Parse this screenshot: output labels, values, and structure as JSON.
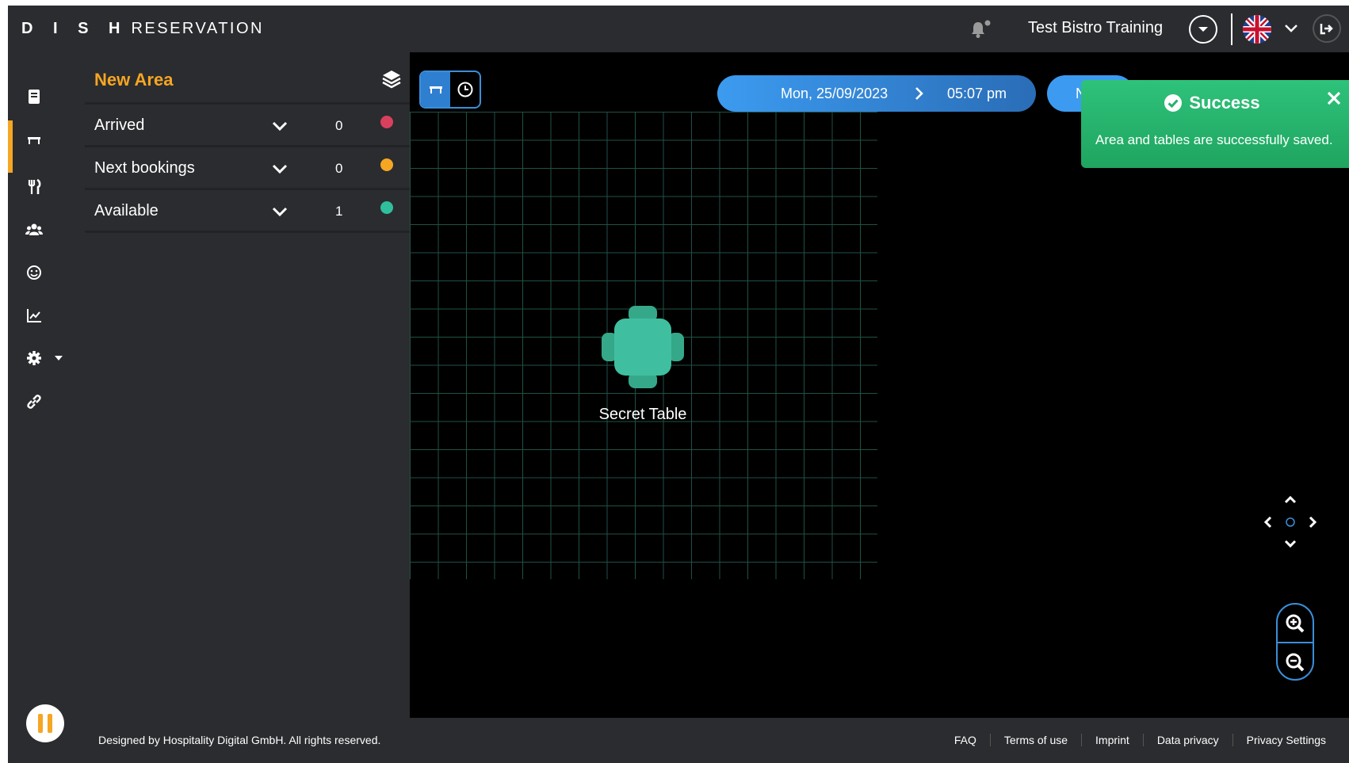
{
  "header": {
    "logo_brand": "D I S H",
    "logo_product": "RESERVATION",
    "restaurant_name": "Test Bistro Training",
    "language": "English (UK)"
  },
  "sidebar": {
    "items": [
      {
        "icon": "book-icon"
      },
      {
        "icon": "table-icon",
        "active": true
      },
      {
        "icon": "cutlery-icon"
      },
      {
        "icon": "guests-icon"
      },
      {
        "icon": "smiley-icon"
      },
      {
        "icon": "chart-icon"
      },
      {
        "icon": "gear-icon"
      },
      {
        "icon": "link-icon"
      }
    ]
  },
  "panel": {
    "area_title": "New Area",
    "statuses": [
      {
        "label": "Arrived",
        "count": "0",
        "color": "#d9405e"
      },
      {
        "label": "Next bookings",
        "count": "0",
        "color": "#f5a623"
      },
      {
        "label": "Available",
        "count": "1",
        "color": "#2fbf9d"
      }
    ]
  },
  "canvas": {
    "date": "Mon, 25/09/2023",
    "time": "05:07 pm",
    "second_pill_text": "N",
    "table_name": "Secret Table",
    "table_color": "#3fbf9f"
  },
  "toast": {
    "title": "Success",
    "message": "Area and tables are successfully saved.",
    "color": "#2ec27a"
  },
  "footer": {
    "copyright": "Designed by Hospitality Digital GmbH. All rights reserved.",
    "links": [
      "FAQ",
      "Terms of use",
      "Imprint",
      "Data privacy",
      "Privacy Settings"
    ]
  },
  "colors": {
    "accent": "#f5a623",
    "primary_blue": "#3c9bf0",
    "background": "#2b2c2f"
  }
}
